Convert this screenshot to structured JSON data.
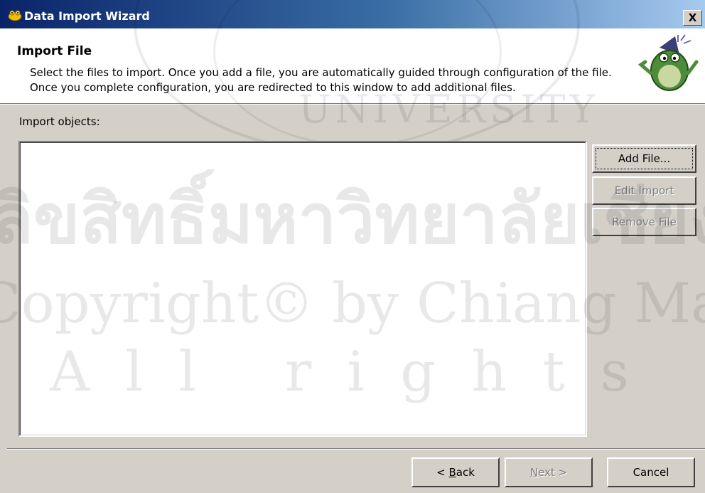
{
  "window": {
    "title": "Data Import Wizard",
    "close_label": "X"
  },
  "header": {
    "title": "Import File",
    "description": "Select the files to import.  Once you add a file, you are automatically guided through configuration of the file.  Once you complete configuration, you are redirected to this window to add additional files."
  },
  "main": {
    "section_label": "Import objects:",
    "import_objects": []
  },
  "side_buttons": {
    "add_file": "Add File...",
    "edit_import": "Edit Import",
    "remove_file": "Remove File"
  },
  "nav_buttons": {
    "back_prefix": "< ",
    "back_mnemonic": "B",
    "back_rest": "ack",
    "next_mnemonic": "N",
    "next_rest": "ext >",
    "cancel": "Cancel"
  },
  "watermark": {
    "line1": "ลิขสิทธิ์มหาวิทยาลัยเชียงใหม่",
    "line2": "Copyright© by Chiang Mai University",
    "line3": "All rights reserved",
    "seal_text": "UNIVERSITY"
  },
  "colors": {
    "titlebar_start": "#0a246a",
    "titlebar_end": "#a6caf0",
    "dialog_face": "#d4d0c8",
    "disabled_text": "#808080"
  }
}
